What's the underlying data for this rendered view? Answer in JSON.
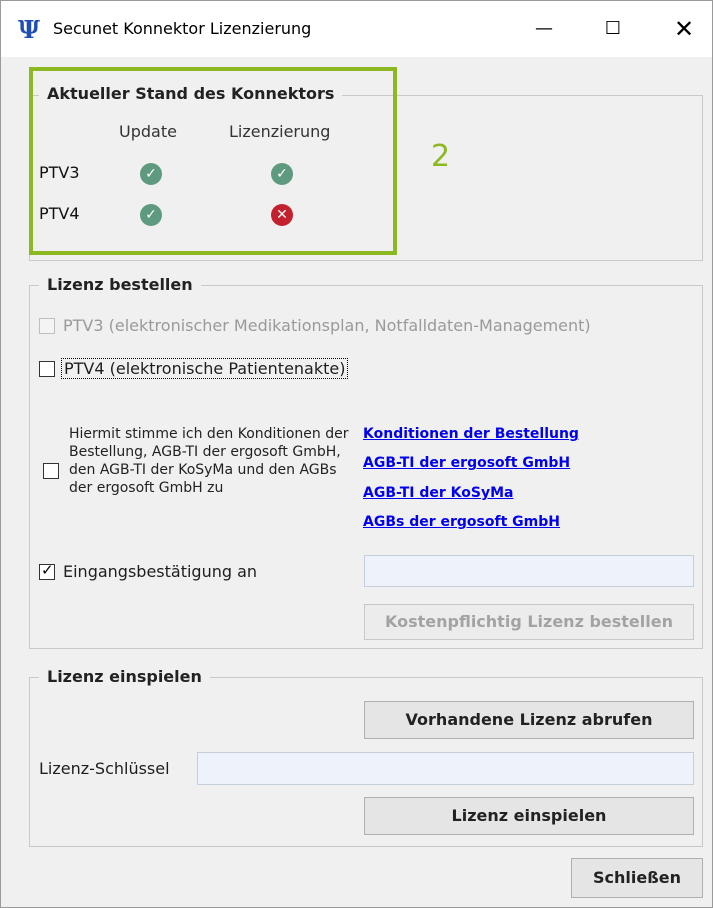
{
  "window": {
    "title": "Secunet Konnektor Lizenzierung",
    "app_icon_glyph": "Ψ",
    "min_glyph": "—",
    "max_glyph": "☐",
    "close_glyph": "✕"
  },
  "status": {
    "legend": "Aktueller Stand des Konnektors",
    "col_update": "Update",
    "col_license": "Lizenzierung",
    "rows": [
      {
        "label": "PTV3",
        "update": "ok",
        "license": "ok"
      },
      {
        "label": "PTV4",
        "update": "ok",
        "license": "error"
      }
    ],
    "annotation": "2",
    "ok_glyph": "✓",
    "error_glyph": "✕",
    "highlight_color": "#8cb822"
  },
  "order": {
    "legend": "Lizenz bestellen",
    "ptv3_label": "PTV3 (elektronischer Medikationsplan, Notfalldaten-Management)",
    "ptv4_label": "PTV4 (elektronische Patientenakte)",
    "agb_text": "Hiermit stimme ich den Konditionen der Bestellung, AGB-TI der ergosoft GmbH, den AGB-TI der KoSyMa und den AGBs der ergosoft GmbH zu",
    "links": [
      "Konditionen der Bestellung",
      "AGB-TI der ergosoft GmbH",
      "AGB-TI der KoSyMa",
      "AGBs der ergosoft GmbH"
    ],
    "confirmation_label": "Eingangsbestätigung an",
    "confirmation_checked": true,
    "email_value": "",
    "order_button": "Kostenpflichtig Lizenz bestellen"
  },
  "install": {
    "legend": "Lizenz einspielen",
    "fetch_button": "Vorhandene Lizenz abrufen",
    "key_label": "Lizenz-Schlüssel",
    "key_value": "",
    "install_button": "Lizenz einspielen"
  },
  "footer": {
    "close_button": "Schließen"
  }
}
